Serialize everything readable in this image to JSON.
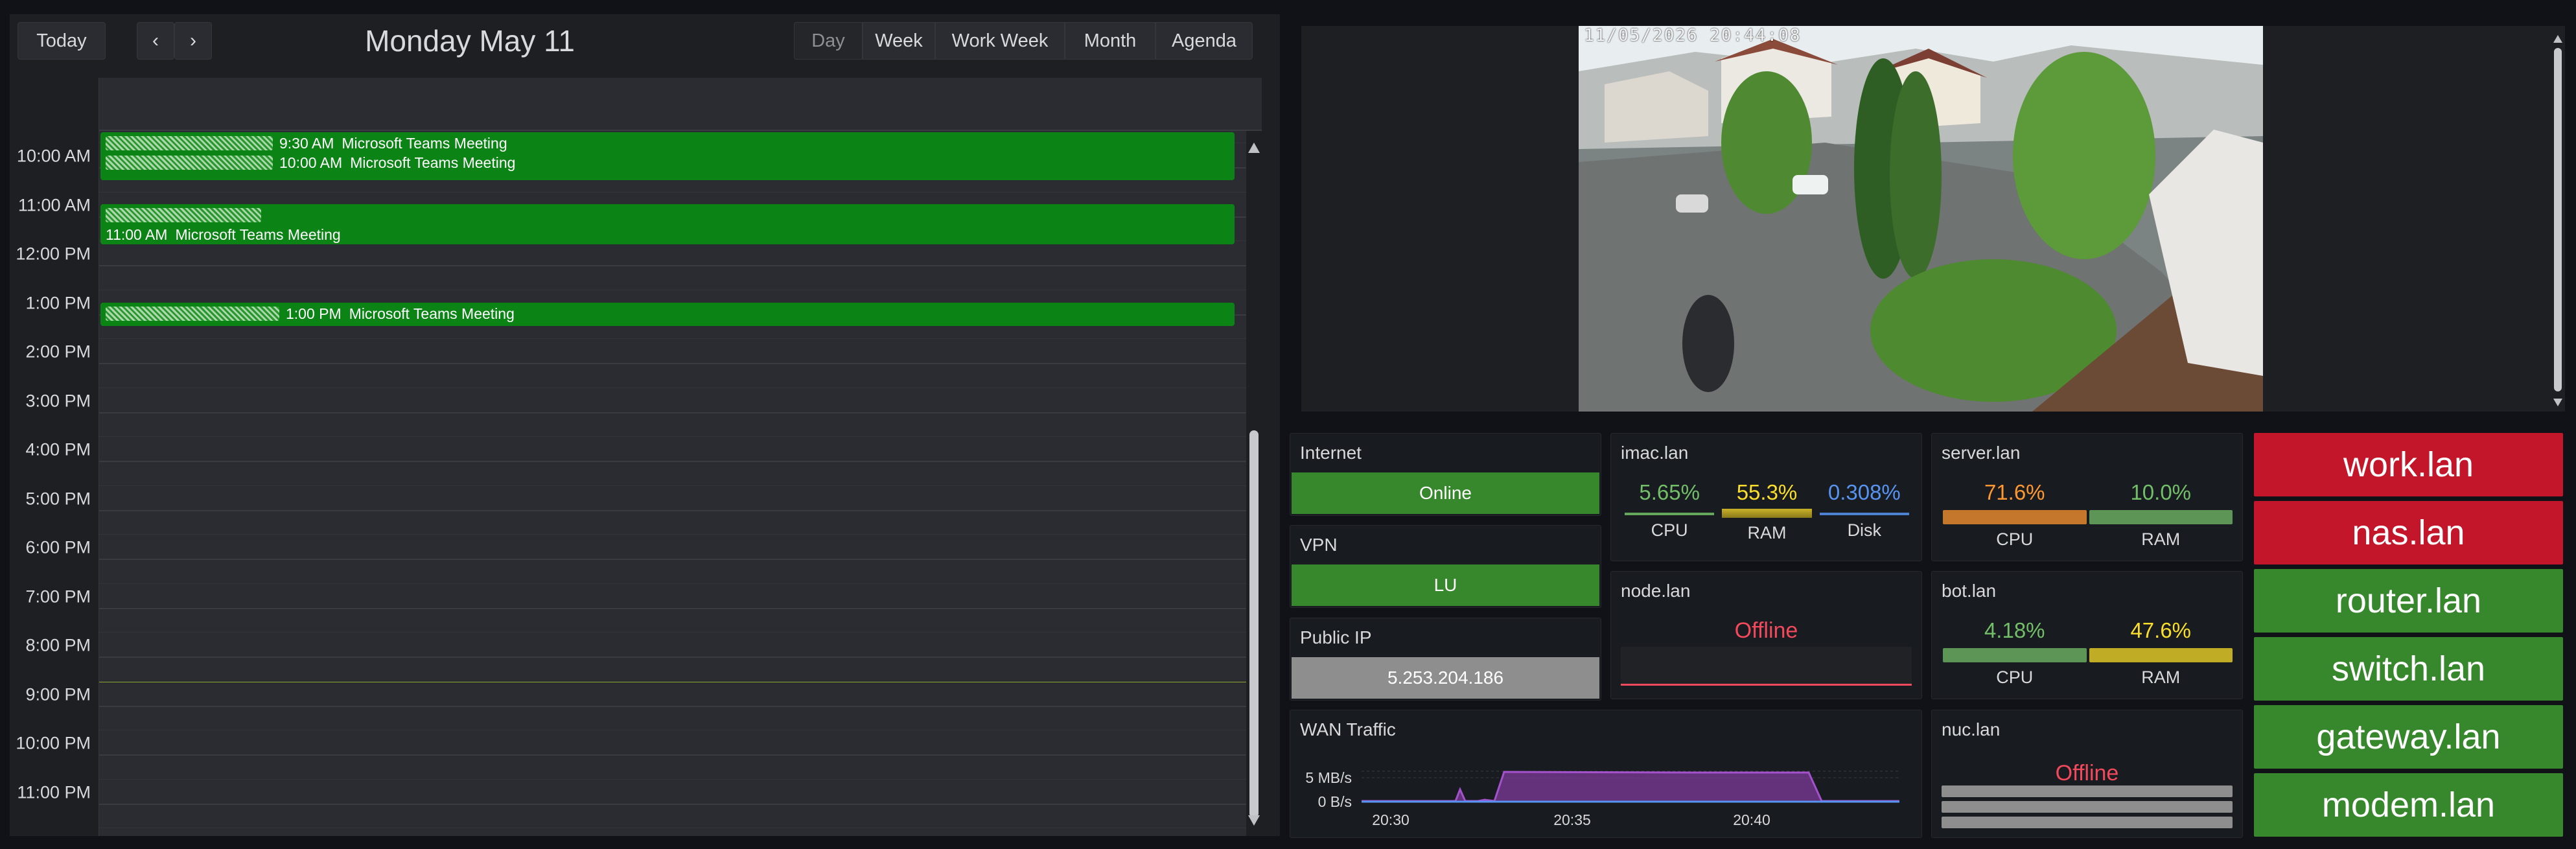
{
  "calendar": {
    "today_label": "Today",
    "prev_label": "‹",
    "next_label": "›",
    "title": "Monday May 11",
    "views": {
      "day": "Day",
      "week": "Week",
      "work_week": "Work Week",
      "month": "Month",
      "agenda": "Agenda"
    },
    "active_view": "Day",
    "time_slots": [
      "10:00 AM",
      "11:00 AM",
      "12:00 PM",
      "1:00 PM",
      "2:00 PM",
      "3:00 PM",
      "4:00 PM",
      "5:00 PM",
      "6:00 PM",
      "7:00 PM",
      "8:00 PM",
      "9:00 PM",
      "10:00 PM",
      "11:00 PM"
    ],
    "events": [
      {
        "time": "9:30 AM",
        "title": "Microsoft Teams Meeting"
      },
      {
        "time": "10:00 AM",
        "title": "Microsoft Teams Meeting"
      },
      {
        "time": "11:00 AM",
        "title": "Microsoft Teams Meeting"
      },
      {
        "time": "1:00 PM",
        "title": "Microsoft Teams Meeting"
      }
    ],
    "current_time_line": "8:30 PM",
    "event_color": "#0b8415"
  },
  "camera": {
    "timestamp": "11/05/2026 20:44:08"
  },
  "internet": {
    "title": "Internet",
    "status": "Online",
    "status_color": "#37872d"
  },
  "vpn": {
    "title": "VPN",
    "status": "LU",
    "status_color": "#37872d"
  },
  "public_ip": {
    "title": "Public IP",
    "value": "5.253.204.186",
    "value_color": "#8e8e8e"
  },
  "wan": {
    "title": "WAN Traffic",
    "y_ticks": [
      "5 MB/s",
      "0 B/s"
    ],
    "x_ticks": [
      "20:30",
      "20:35",
      "20:40"
    ]
  },
  "imac": {
    "title": "imac.lan",
    "metrics": [
      {
        "label": "CPU",
        "value": "5.65%",
        "fraction": 0.0565,
        "color": "#73bf69"
      },
      {
        "label": "RAM",
        "value": "55.3%",
        "fraction": 0.553,
        "color": "#fade2a"
      },
      {
        "label": "Disk",
        "value": "0.308%",
        "fraction": 0.003,
        "color": "#5794f2"
      }
    ]
  },
  "server": {
    "title": "server.lan",
    "metrics": [
      {
        "label": "CPU",
        "value": "71.6%",
        "fraction": 0.716,
        "color": "#ff9830"
      },
      {
        "label": "RAM",
        "value": "10.0%",
        "fraction": 0.1,
        "color": "#73bf69"
      }
    ]
  },
  "node": {
    "title": "node.lan",
    "status": "Offline"
  },
  "bot": {
    "title": "bot.lan",
    "metrics": [
      {
        "label": "CPU",
        "value": "4.18%",
        "fraction": 0.0418,
        "color": "#73bf69"
      },
      {
        "label": "RAM",
        "value": "47.6%",
        "fraction": 0.476,
        "color": "#fade2a"
      }
    ]
  },
  "nuc": {
    "title": "nuc.lan",
    "status": "Offline"
  },
  "hosts": [
    {
      "name": "work.lan",
      "state": "down"
    },
    {
      "name": "nas.lan",
      "state": "down"
    },
    {
      "name": "router.lan",
      "state": "up"
    },
    {
      "name": "switch.lan",
      "state": "up"
    },
    {
      "name": "gateway.lan",
      "state": "up"
    },
    {
      "name": "modem.lan",
      "state": "up"
    }
  ],
  "colors": {
    "up": "#37872d",
    "down": "#c4162a",
    "traffic": "#a352cc",
    "traffic_base": "#5794f2"
  }
}
